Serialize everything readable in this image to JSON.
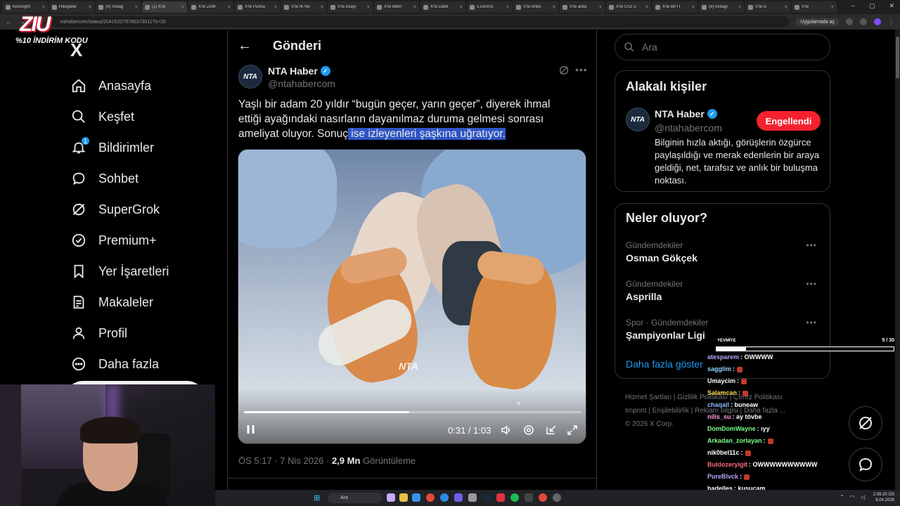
{
  "browser": {
    "tabs": [
      "KickSight",
      "Hikayeler",
      "(9) Instag",
      "(1) X'te",
      "X'te ZAM",
      "X'te Pusha",
      "X'te İK Ne",
      "X'te Asayi",
      "X'te Metn",
      "X'te Dakti",
      "x.com/cli",
      "X'te Anbo",
      "X'te arda",
      "X'te CS2 C",
      "X'te BPTI",
      "(9) Instagr",
      "X'te D",
      "X'te"
    ],
    "url": "nahabercom/status/204152079786373511?s=20",
    "open_in_app": "Uygulamada aç"
  },
  "overlay": {
    "logo": "ZIU",
    "promo": "%10 İNDİRİM KODU"
  },
  "nav": {
    "logo": "X",
    "items": [
      {
        "label": "Anasayfa",
        "icon": "home-icon"
      },
      {
        "label": "Keşfet",
        "icon": "search-icon"
      },
      {
        "label": "Bildirimler",
        "icon": "bell-icon",
        "badge": "1"
      },
      {
        "label": "Sohbet",
        "icon": "chat-icon"
      },
      {
        "label": "SuperGrok",
        "icon": "grok-icon"
      },
      {
        "label": "Premium+",
        "icon": "premium-icon"
      },
      {
        "label": "Yer İşaretleri",
        "icon": "bookmark-icon"
      },
      {
        "label": "Makaleler",
        "icon": "article-icon"
      },
      {
        "label": "Profil",
        "icon": "profile-icon"
      },
      {
        "label": "Daha fazla",
        "icon": "more-icon"
      }
    ]
  },
  "post": {
    "header_title": "Gönderi",
    "author_name": "NTA Haber",
    "author_handle": "@ntahabercom",
    "avatar_text": "NTA",
    "text_plain": "Yaşlı bir adam 20 yıldır “bugün geçer, yarın geçer”, diyerek ihmal ettiği ayağındaki nasırların dayanılmaz duruma gelmesi sonrası ameliyat oluyor. Sonuç",
    "text_highlighted": " ise izleyenleri şaşkına uğratıyor.",
    "video": {
      "watermark": "NTA",
      "current_time": "0:31",
      "duration": "1:03",
      "progress": 0.49
    },
    "meta_time": "ÖS 5:17 · 7 Nis 2026 · ",
    "views_value": "2,9 Mn",
    "views_label": " Görüntüleme"
  },
  "sidebar": {
    "search_placeholder": "Ara",
    "related_title": "Alakalı kişiler",
    "related": {
      "name": "NTA Haber",
      "handle": "@ntahabercom",
      "avatar_text": "NTA",
      "button": "Engellendi",
      "bio": "Bilginin hızla aktığı, görüşlerin özgürce paylaşıldığı ve merak edenlerin bir araya geldiği, net, tarafsız ve anlık bir buluşma noktası."
    },
    "trends_title": "Neler oluyor?",
    "trends": [
      {
        "category": "Gündemdekiler",
        "name": "Osman Gökçek"
      },
      {
        "category": "Gündemdekiler",
        "name": "Asprilla"
      },
      {
        "category": "Spor · Gündemdekiler",
        "name": "Şampiyonlar Ligi"
      }
    ],
    "show_more": "Daha fazla göster",
    "footer": [
      "Hizmet Şartları",
      "Gizlilik Politikası",
      "Çerez Politikası",
      "Imprint",
      "Erişilebilirlik",
      "Reklam bilgisi",
      "Daha fazla ...",
      "© 2026 X Corp."
    ]
  },
  "stream": {
    "goal_label": "YEVMİYE",
    "goal_count": "5 / 30",
    "goal_progress": 0.1667,
    "messages": [
      {
        "user": "atesparem",
        "text": ": OWWWW",
        "color": "#b9a6ff"
      },
      {
        "user": "sagglim",
        "text": ":",
        "color": "#8fd3ff"
      },
      {
        "user": "Umaycim",
        "text": ":",
        "color": "#ffffff"
      },
      {
        "user": "Salamcan",
        "text": ":",
        "color": "#ffe45c"
      },
      {
        "user": "chaqall",
        "text": ": buneaw",
        "color": "#8fb8ff"
      },
      {
        "user": "nilis_su",
        "text": ": ay tövbe",
        "color": "#ff9de0"
      },
      {
        "user": "DomDomWayne",
        "text": ": ıyy",
        "color": "#7dff8a"
      },
      {
        "user": "Arkadan_zorlayan",
        "text": ":",
        "color": "#7dff8a"
      },
      {
        "user": "nik0bel11c",
        "text": ":",
        "color": "#ffffff"
      },
      {
        "user": "Buldozeryigit",
        "text": ": OWWWWWWWWWW",
        "color": "#ff6b7a"
      },
      {
        "user": "PureBlvck",
        "text": ":",
        "color": "#b9a6ff"
      },
      {
        "user": "hadelles",
        "text": ": kusucam",
        "color": "#ffffff"
      }
    ]
  },
  "taskbar": {
    "search": "Ara",
    "time": "2:09:20 ÖS",
    "date": "8.04.2026"
  }
}
